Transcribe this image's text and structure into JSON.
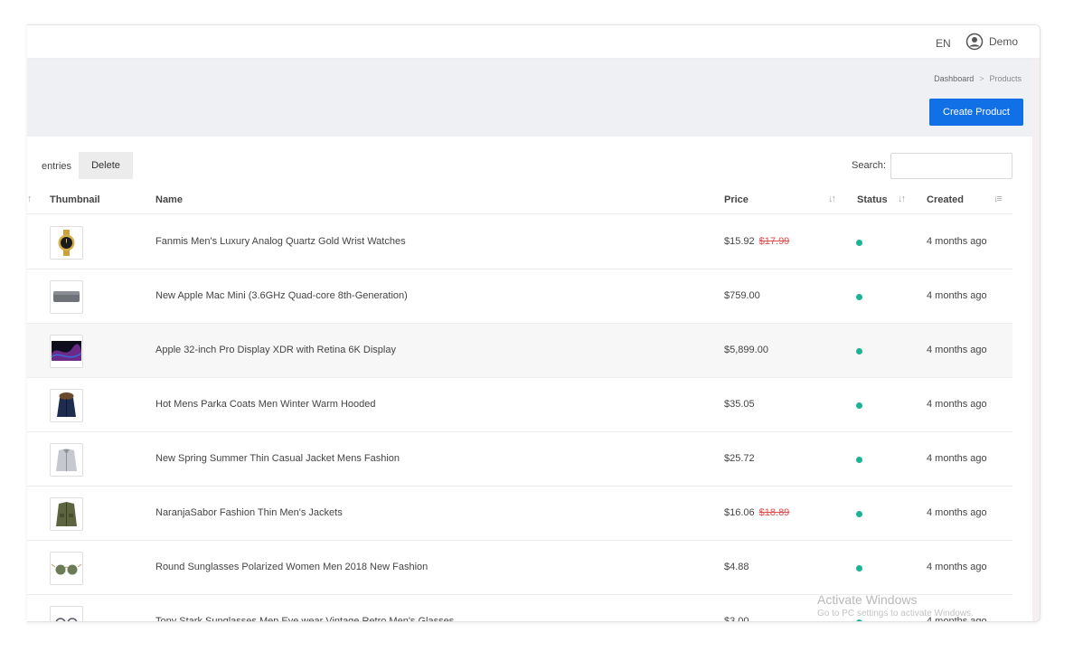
{
  "topbar": {
    "language": "EN",
    "user_name": "Demo"
  },
  "breadcrumb": [
    "Dashboard",
    "Products"
  ],
  "actions": {
    "create_product": "Create Product",
    "delete": "Delete"
  },
  "table_controls": {
    "entries_label": "entries",
    "search_label": "Search:",
    "search_value": ""
  },
  "columns": {
    "thumbnail": "Thumbnail",
    "name": "Name",
    "price": "Price",
    "status": "Status",
    "created": "Created"
  },
  "icons": {
    "sort": "sort-icon",
    "user": "user-circle-icon",
    "status": "status-dot-icon"
  },
  "colors": {
    "primary": "#1170e6",
    "status_active": "#1ab394",
    "old_price": "#e04b4b"
  },
  "products": [
    {
      "name": "Fanmis Men's Luxury Analog Quartz Gold Wrist Watches",
      "price": "$15.92",
      "old_price": "$17.99",
      "created": "4 months ago",
      "thumb": "watch"
    },
    {
      "name": "New Apple Mac Mini (3.6GHz Quad-core 8th-Generation)",
      "price": "$759.00",
      "old_price": "",
      "created": "4 months ago",
      "thumb": "macmini"
    },
    {
      "name": "Apple 32-inch Pro Display XDR with Retina 6K Display",
      "price": "$5,899.00",
      "old_price": "",
      "created": "4 months ago",
      "thumb": "display"
    },
    {
      "name": "Hot Mens Parka Coats Men Winter Warm Hooded",
      "price": "$35.05",
      "old_price": "",
      "created": "4 months ago",
      "thumb": "parka"
    },
    {
      "name": "New Spring Summer Thin Casual Jacket Mens Fashion",
      "price": "$25.72",
      "old_price": "",
      "created": "4 months ago",
      "thumb": "jacket"
    },
    {
      "name": "NaranjaSabor Fashion Thin Men's Jackets",
      "price": "$16.06",
      "old_price": "$18.89",
      "created": "4 months ago",
      "thumb": "greenjacket"
    },
    {
      "name": "Round Sunglasses Polarized Women Men 2018 New Fashion",
      "price": "$4.88",
      "old_price": "",
      "created": "4 months ago",
      "thumb": "sunglasses"
    },
    {
      "name": "Tony Stark Sunglasses Men Eye wear Vintage Retro Men's Glasses",
      "price": "$3.00",
      "old_price": "",
      "created": "4 months ago",
      "thumb": "glasses"
    }
  ],
  "watermark": {
    "line1": "Activate Windows",
    "line2": "Go to PC settings to activate Windows."
  }
}
